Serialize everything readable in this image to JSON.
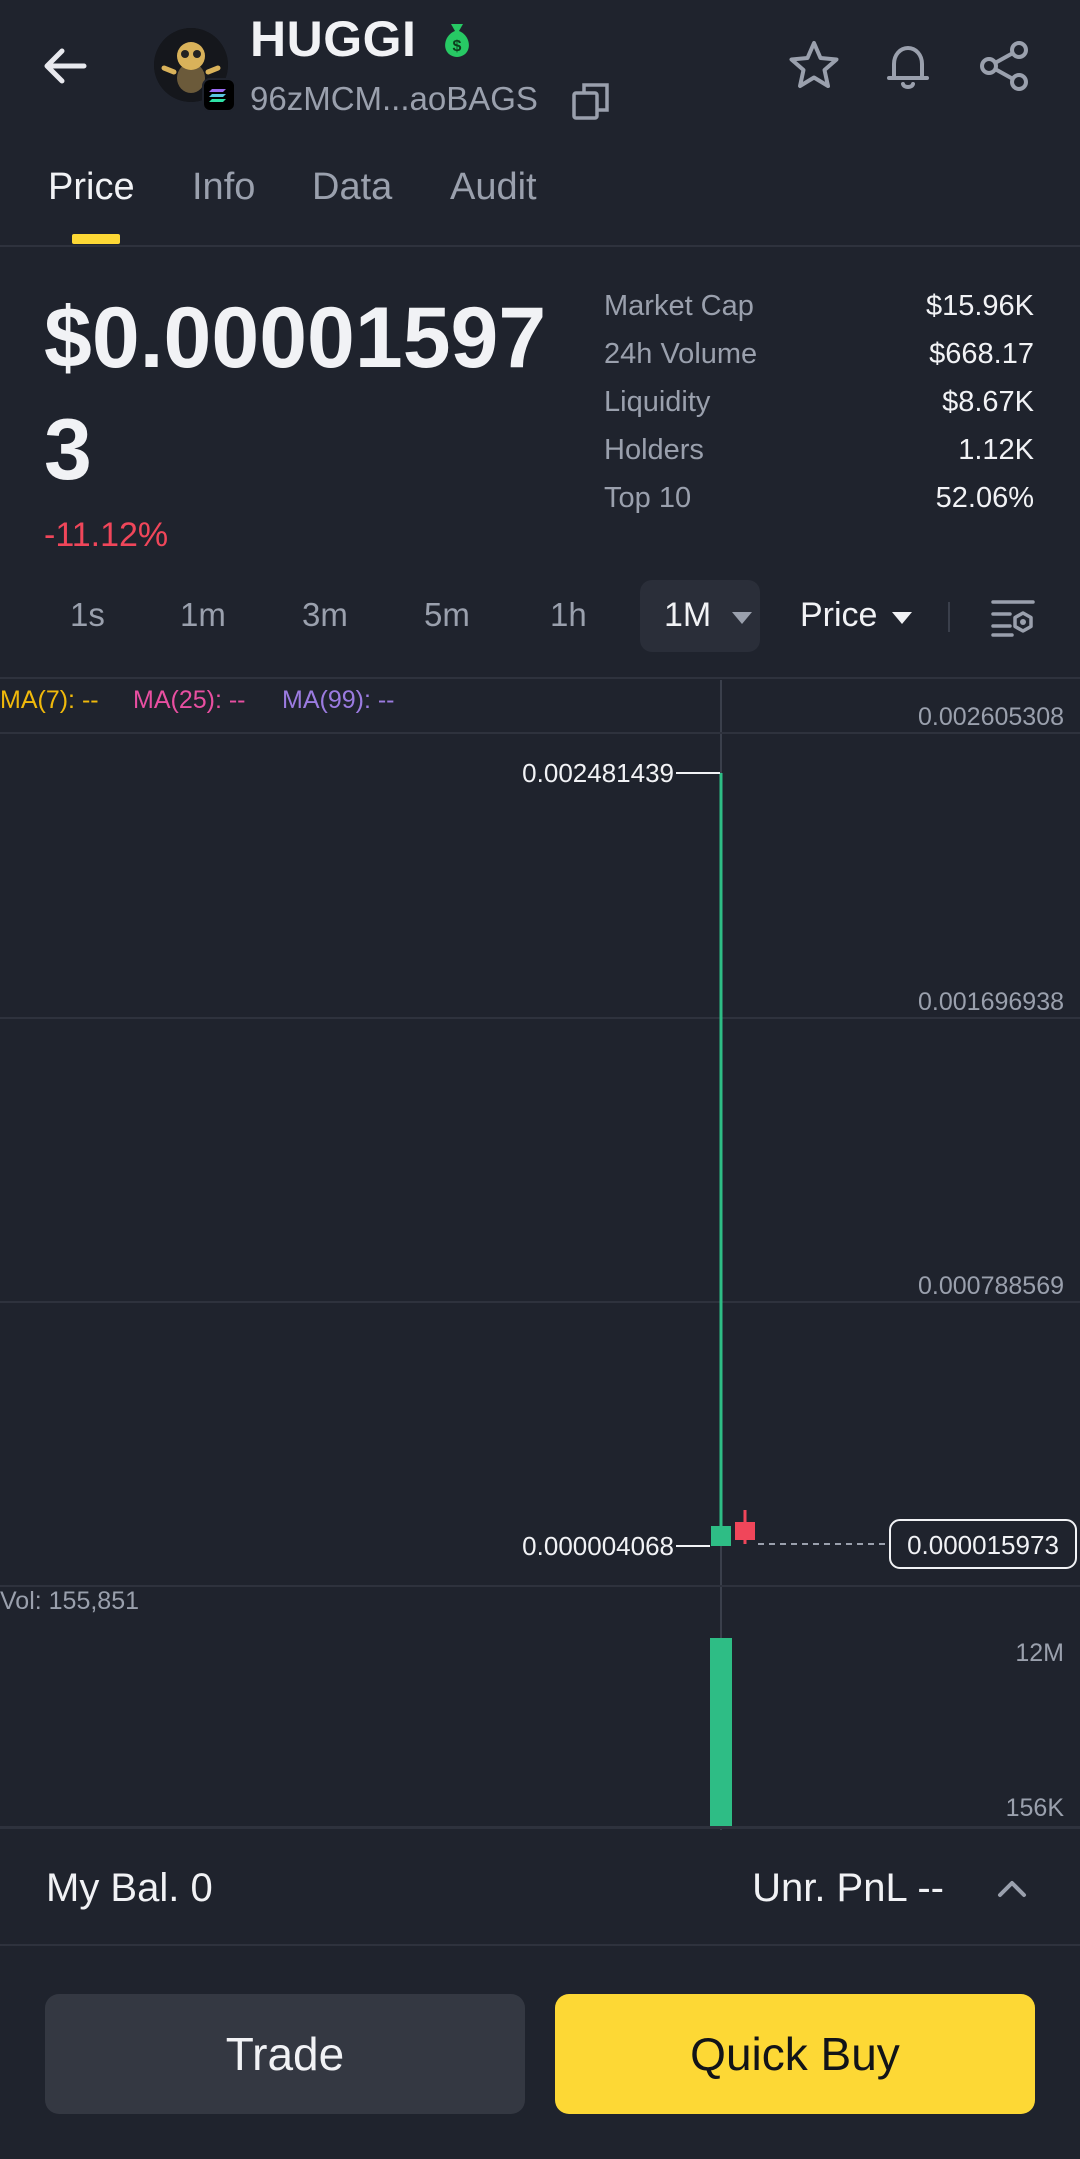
{
  "header": {
    "token_name": "HUGGI",
    "address": "96zMCM...aoBAGS",
    "icons": [
      "back-arrow-icon",
      "money-bag-icon",
      "copy-icon",
      "star-icon",
      "bell-icon",
      "share-icon"
    ]
  },
  "tabs": [
    {
      "label": "Price",
      "active": true
    },
    {
      "label": "Info"
    },
    {
      "label": "Data"
    },
    {
      "label": "Audit"
    }
  ],
  "price": {
    "value": "$0.000015973",
    "change": "-11.12%"
  },
  "stats": [
    {
      "label": "Market Cap",
      "value": "$15.96K"
    },
    {
      "label": "24h Volume",
      "value": "$668.17"
    },
    {
      "label": "Liquidity",
      "value": "$8.67K"
    },
    {
      "label": "Holders",
      "value": "1.12K"
    },
    {
      "label": "Top 10",
      "value": "52.06%"
    }
  ],
  "intervals": [
    "1s",
    "1m",
    "3m",
    "5m",
    "1h"
  ],
  "selected_interval": "1M",
  "price_mode": "Price",
  "chart_data": {
    "type": "candlestick",
    "indicators": [
      {
        "label": "MA(7): --",
        "color": "#f0b90b"
      },
      {
        "label": "MA(25): --",
        "color": "#e84fa1"
      },
      {
        "label": "MA(99): --",
        "color": "#9b7be0"
      }
    ],
    "y_ticks": [
      "0.002605308",
      "0.001696938",
      "0.000788569"
    ],
    "ylim": [
      0,
      0.002605308
    ],
    "candles": [
      {
        "open": 4.068e-06,
        "high": 0.002481439,
        "low": 4.068e-06,
        "close": 1e-05,
        "direction": "up"
      },
      {
        "open": 1.8e-05,
        "high": 3e-05,
        "low": 4.068e-06,
        "close": 1.5973e-05,
        "direction": "down"
      }
    ],
    "high_label": "0.002481439",
    "low_label": "0.000004068",
    "last_price_label": "0.000015973",
    "volume": {
      "label": "Vol: 155,851",
      "y_ticks": [
        "12M",
        "156K"
      ],
      "bars": [
        {
          "value": 12000000,
          "direction": "up"
        },
        {
          "value": 155851,
          "direction": "down"
        }
      ]
    },
    "up_color": "#2ebd85",
    "down_color": "#f0465a"
  },
  "balance": {
    "my_bal": "My Bal. 0",
    "pnl": "Unr. PnL --"
  },
  "buttons": {
    "trade": "Trade",
    "quick_buy": "Quick Buy"
  },
  "colors": {
    "background": "#1f232d",
    "accent": "#fdd835",
    "negative": "#f0465a",
    "positive": "#2ebd85"
  }
}
